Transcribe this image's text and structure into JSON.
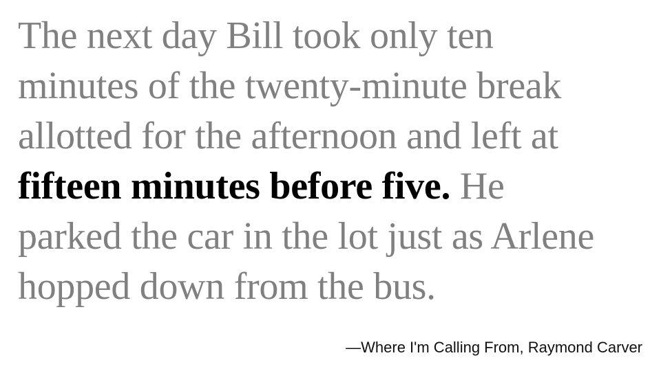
{
  "quote": {
    "line1": "The next day Bill took only ten",
    "line2": "minutes of the twenty-minute break",
    "line3": "allotted for the afternoon and left at",
    "line4_highlight": "fifteen minutes before five.",
    "line4_rest": " He",
    "line5": "parked the car in the lot just as Arlene",
    "line6": "hopped down from the bus."
  },
  "attribution": "—Where I'm Calling From, Raymond Carver",
  "colors": {
    "body_text": "#808080",
    "highlight_text": "#000000",
    "background": "#ffffff"
  }
}
